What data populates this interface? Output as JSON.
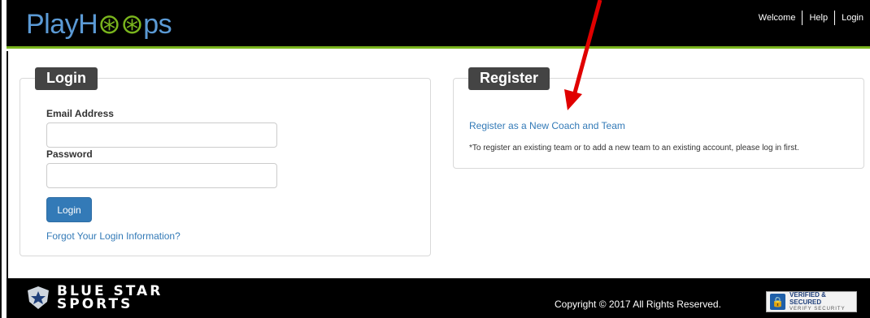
{
  "header": {
    "logo_text_a": "Play",
    "logo_text_b": "H",
    "logo_text_c": "ps",
    "nav": [
      "Welcome",
      "Help",
      "Login"
    ]
  },
  "login": {
    "title": "Login",
    "email_label": "Email Address",
    "email_value": "",
    "password_label": "Password",
    "password_value": "",
    "login_button": "Login",
    "forgot_link": "Forgot Your Login Information?"
  },
  "register": {
    "title": "Register",
    "new_coach_link": "Register as a New Coach and Team",
    "note": "*To register an existing team or to add a new team to an existing account, please log in first."
  },
  "footer": {
    "brand_line1": "BLUE STAR",
    "brand_line2": "SPORTS",
    "copyright": "Copyright © 2017 All Rights Reserved.",
    "badge_line1": "VERIFIED & SECURED",
    "badge_line2": "VERIFY SECURITY"
  },
  "colors": {
    "header_bg": "#000000",
    "accent_green": "#7ab51d",
    "logo_blue": "#5b9ad5",
    "link_blue": "#337ab7",
    "button_blue": "#337ab7",
    "panel_title_bg": "#444444",
    "annotation_arrow": "#e00000"
  }
}
